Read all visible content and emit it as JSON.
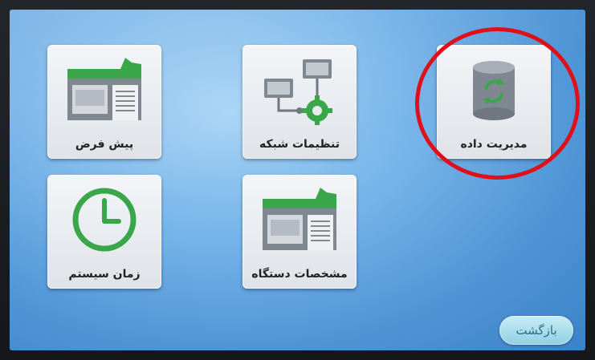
{
  "tiles": {
    "data_management": {
      "label": "مدیریت داده",
      "icon": "database-sync-icon"
    },
    "network_settings": {
      "label": "تنظیمات شبکه",
      "icon": "network-settings-icon"
    },
    "defaults": {
      "label": "پیش فرض",
      "icon": "device-defaults-icon"
    },
    "device_specs": {
      "label": "مشخصات دستگاه",
      "icon": "device-specs-icon"
    },
    "system_time": {
      "label": "زمان سیستم",
      "icon": "clock-icon"
    }
  },
  "back_button": {
    "label": "بازگشت"
  },
  "colors": {
    "highlight_ring": "#e0101a",
    "accent_green": "#3aa64a",
    "screen_blue": "#79b6ea"
  }
}
